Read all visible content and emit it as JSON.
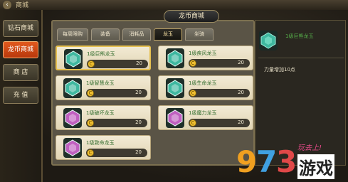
{
  "header": {
    "title": "商城"
  },
  "left_menu": {
    "items": [
      {
        "label": "钻石商城",
        "active": false
      },
      {
        "label": "龙币商城",
        "active": true
      },
      {
        "label": "商 店",
        "active": false
      },
      {
        "label": "充 值",
        "active": false
      }
    ]
  },
  "shop": {
    "title": "龙币商城",
    "tabs": [
      {
        "label": "每周限购",
        "active": false
      },
      {
        "label": "装备",
        "active": false
      },
      {
        "label": "消耗品",
        "active": false
      },
      {
        "label": "龙玉",
        "active": true
      },
      {
        "label": "坐骑",
        "active": false
      }
    ],
    "items": [
      {
        "name": "1级巨熊龙玉",
        "price": "20",
        "color": "#3fb8a0",
        "selected": true
      },
      {
        "name": "1级疾风龙玉",
        "price": "20",
        "color": "#3fb8a0",
        "selected": false
      },
      {
        "name": "1级智慧龙玉",
        "price": "20",
        "color": "#3fb8a0",
        "selected": false
      },
      {
        "name": "1级生命龙玉",
        "price": "20",
        "color": "#3fb8a0",
        "selected": false
      },
      {
        "name": "1级破坏龙玉",
        "price": "20",
        "color": "#c060c0",
        "selected": false
      },
      {
        "name": "1级魔力龙玉",
        "price": "20",
        "color": "#c060c0",
        "selected": false
      },
      {
        "name": "1级致命龙玉",
        "price": "20",
        "color": "#c060c0",
        "selected": false
      }
    ],
    "coin_icon": "C"
  },
  "detail": {
    "name": "1级巨熊龙玉",
    "description": "力量增加10点",
    "gem_color": "#3fb8a0"
  },
  "watermark": {
    "digits": [
      "9",
      "7",
      "3"
    ],
    "text": "游戏",
    "slogan": "玩去上!"
  }
}
